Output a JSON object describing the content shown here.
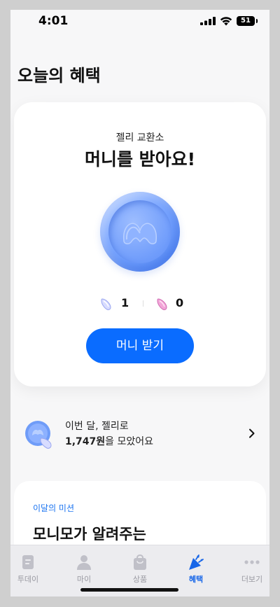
{
  "status_bar": {
    "time": "4:01",
    "battery_level": "51"
  },
  "page": {
    "title": "오늘의 혜택"
  },
  "exchange_card": {
    "subtitle": "젤리 교환소",
    "title": "머니를 받아요!",
    "jelly_blue_count": "1",
    "jelly_pink_count": "0",
    "cta_label": "머니 받기",
    "accent_color": "#0a6cff"
  },
  "summary": {
    "line1": "이번 달, 젤리로",
    "amount": "1,747원",
    "line2_suffix": "을 모았어요"
  },
  "mission": {
    "tag": "이달의 미션",
    "title": "모니모가 알려주는"
  },
  "tabbar": {
    "items": [
      {
        "label": "투데이",
        "icon": "document-icon"
      },
      {
        "label": "마이",
        "icon": "person-icon"
      },
      {
        "label": "상품",
        "icon": "shopping-bag-icon"
      },
      {
        "label": "혜택",
        "icon": "party-popper-icon"
      },
      {
        "label": "더보기",
        "icon": "more-dots-icon"
      }
    ],
    "active_index": 3,
    "active_color": "#1766e8"
  }
}
